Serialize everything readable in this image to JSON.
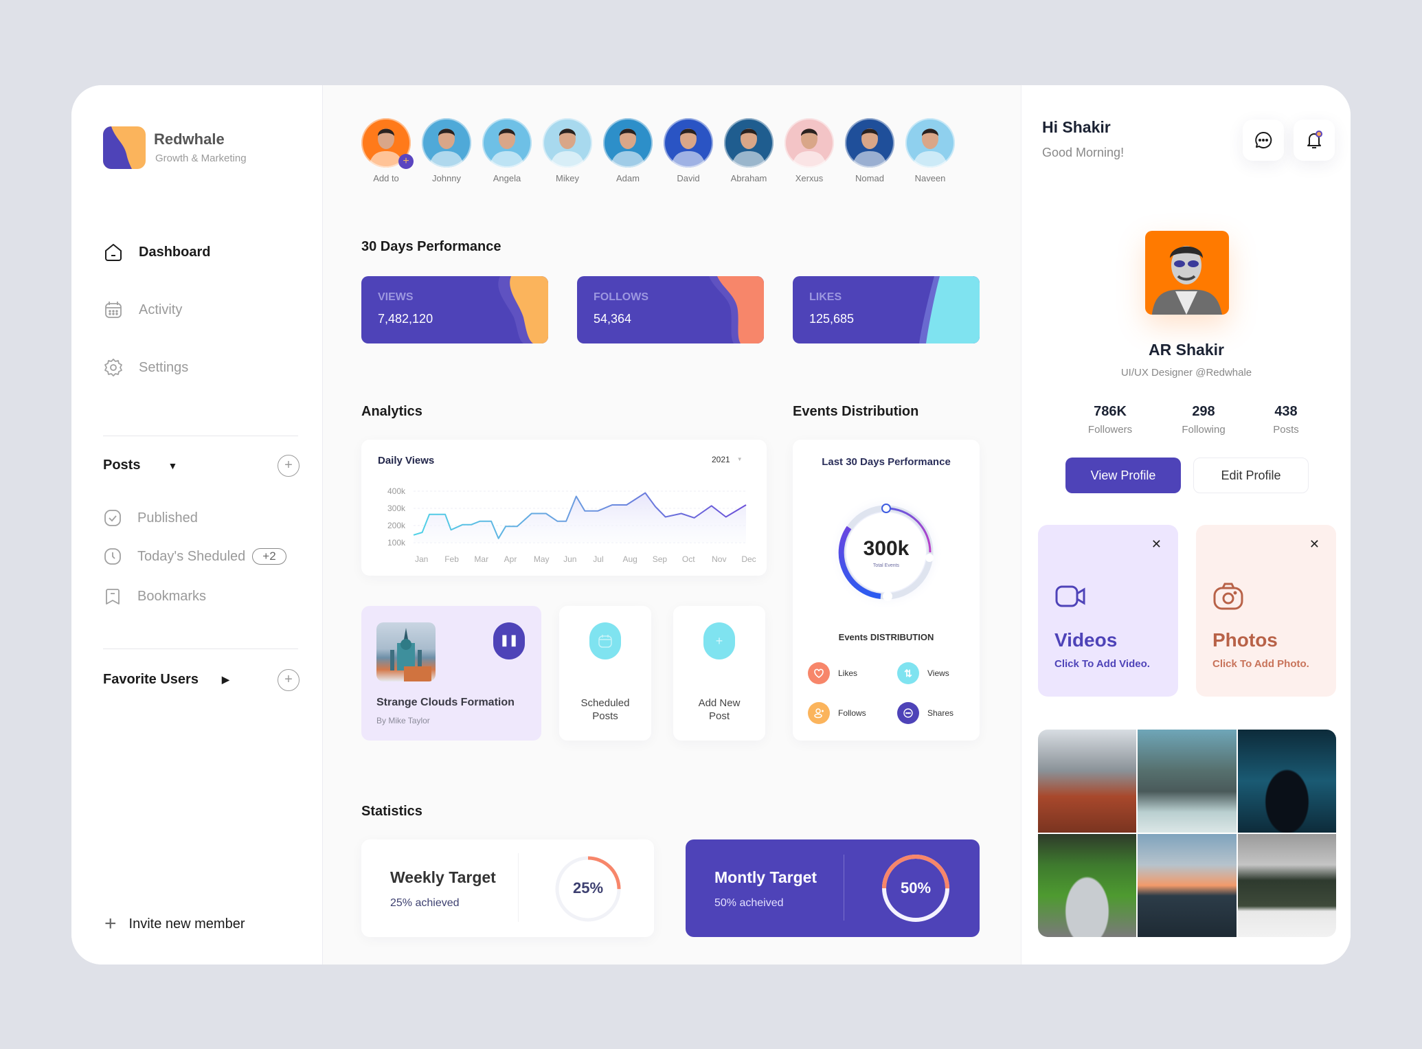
{
  "brand": {
    "name": "Redwhale",
    "tagline": "Growth & Marketing",
    "colors": {
      "primary": "#4e43b8",
      "orange": "#fbb45c",
      "coral": "#f7866a",
      "cyan": "#7fe3f0"
    }
  },
  "nav": [
    {
      "label": "Dashboard",
      "icon": "home-icon",
      "active": true
    },
    {
      "label": "Activity",
      "icon": "calendar-icon",
      "active": false
    },
    {
      "label": "Settings",
      "icon": "gear-icon",
      "active": false
    }
  ],
  "posts_section": {
    "title": "Posts",
    "items": [
      {
        "label": "Published",
        "icon": "check-icon"
      },
      {
        "label": "Today's Sheduled",
        "icon": "clock-icon",
        "badge": "+2"
      },
      {
        "label": "Bookmarks",
        "icon": "bookmark-icon"
      }
    ]
  },
  "favorite_users": {
    "title": "Favorite Users"
  },
  "invite": {
    "label": "Invite new member"
  },
  "stories": [
    {
      "name": "Add to",
      "color": "#ff7a1a"
    },
    {
      "name": "Johnny",
      "color": "#4fa9d8"
    },
    {
      "name": "Angela",
      "color": "#6ec0e6"
    },
    {
      "name": "Mikey",
      "color": "#a8d9ee"
    },
    {
      "name": "Adam",
      "color": "#2d8fc9"
    },
    {
      "name": "David",
      "color": "#2a54c4"
    },
    {
      "name": "Abraham",
      "color": "#1f5d8f"
    },
    {
      "name": "Xerxus",
      "color": "#f3c4c6"
    },
    {
      "name": "Nomad",
      "color": "#1f4f9a"
    },
    {
      "name": "Naveen",
      "color": "#8fd0ee"
    }
  ],
  "performance": {
    "title": "30 Days Performance",
    "cards": [
      {
        "label": "VIEWS",
        "value": "7,482,120",
        "accent": "#fbb45c"
      },
      {
        "label": "FOLLOWS",
        "value": "54,364",
        "accent": "#f7866a"
      },
      {
        "label": "LIKES",
        "value": "125,685",
        "accent": "#7fe3f0"
      }
    ]
  },
  "analytics": {
    "title": "Analytics",
    "chart_data": {
      "type": "line",
      "title": "Daily Views",
      "year": "2021",
      "x": [
        "Jan",
        "Feb",
        "Mar",
        "Apr",
        "May",
        "Jun",
        "Jul",
        "Aug",
        "Sep",
        "Oct",
        "Nov",
        "Dec"
      ],
      "yticks": [
        "400k",
        "300k",
        "200k",
        "100k"
      ],
      "ylim": [
        100000,
        400000
      ],
      "points": [
        [
          0,
          145000
        ],
        [
          0.3,
          160000
        ],
        [
          0.55,
          265000
        ],
        [
          1.1,
          265000
        ],
        [
          1.3,
          175000
        ],
        [
          1.7,
          205000
        ],
        [
          2.0,
          205000
        ],
        [
          2.3,
          225000
        ],
        [
          2.7,
          225000
        ],
        [
          2.95,
          125000
        ],
        [
          3.2,
          195000
        ],
        [
          3.6,
          195000
        ],
        [
          4.1,
          270000
        ],
        [
          4.6,
          270000
        ],
        [
          5.0,
          225000
        ],
        [
          5.3,
          225000
        ],
        [
          5.65,
          370000
        ],
        [
          5.95,
          285000
        ],
        [
          6.4,
          285000
        ],
        [
          6.9,
          320000
        ],
        [
          7.4,
          320000
        ],
        [
          8.05,
          390000
        ],
        [
          8.4,
          310000
        ],
        [
          8.75,
          250000
        ],
        [
          9.3,
          270000
        ],
        [
          9.75,
          245000
        ],
        [
          10.35,
          315000
        ],
        [
          10.85,
          250000
        ],
        [
          11.55,
          320000
        ]
      ],
      "grid": true
    }
  },
  "post_cards": [
    {
      "title": "Strange Clouds Formation",
      "author": "By Mike Taylor"
    },
    {
      "label": "Scheduled Posts"
    },
    {
      "label": "Add New Post"
    }
  ],
  "events": {
    "title": "Events Distribution",
    "card_title": "Last 30 Days Performance",
    "total": "300k",
    "total_label": "Total Events",
    "subtitle": "Events DISTRIBUTION",
    "legend": [
      {
        "label": "Likes",
        "color": "#f7866a"
      },
      {
        "label": "Views",
        "color": "#7fe3f0"
      },
      {
        "label": "Follows",
        "color": "#fbb45c"
      },
      {
        "label": "Shares",
        "color": "#4e43b8"
      }
    ]
  },
  "statistics": {
    "title": "Statistics",
    "weekly": {
      "title": "Weekly Target",
      "sub": "25% achieved",
      "pct_label": "25%",
      "value": 0.25
    },
    "monthly": {
      "title": "Montly Target",
      "sub": "50% acheived",
      "pct_label": "50%",
      "value": 0.5
    }
  },
  "profile": {
    "greeting": "Hi Shakir",
    "greeting_sub": "Good Morning!",
    "name": "AR Shakir",
    "role": "UI/UX Designer @Redwhale",
    "stats": [
      {
        "value": "786K",
        "label": "Followers"
      },
      {
        "value": "298",
        "label": "Following"
      },
      {
        "value": "438",
        "label": "Posts"
      }
    ],
    "view_btn": "View Profile",
    "edit_btn": "Edit Profile"
  },
  "media": [
    {
      "title": "Videos",
      "sub": "Click To Add Video."
    },
    {
      "title": "Photos",
      "sub": "Click To Add Photo."
    }
  ],
  "gallery": [
    "mountain-cabins",
    "rock-boat",
    "hacker-screen",
    "vintage-car",
    "sunset-sea",
    "snowy-forest"
  ]
}
